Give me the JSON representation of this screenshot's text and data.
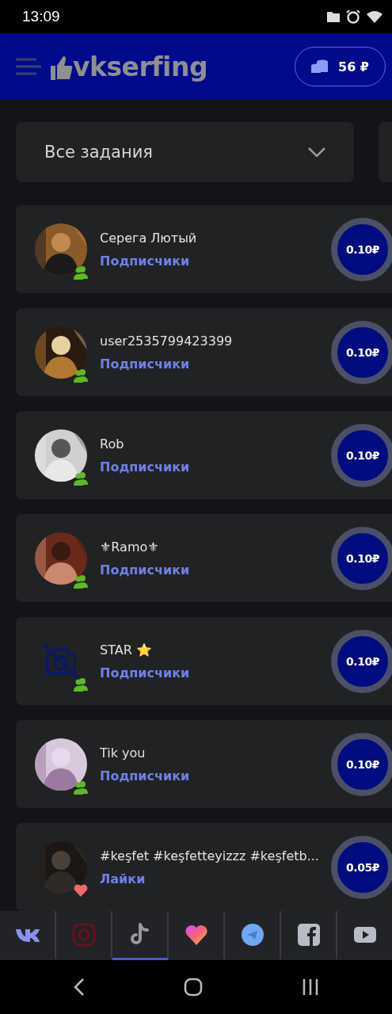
{
  "status_bar": {
    "time": "13:09"
  },
  "header": {
    "logo": "vkserfing",
    "balance": "56 ₽"
  },
  "filter": {
    "value": "Все задания",
    "expanded": false
  },
  "tasks": [
    {
      "name": "Серега Лютый",
      "type": "Подписчики",
      "kind": "subscribers",
      "has_photo": true,
      "price": "0.10₽"
    },
    {
      "name": "user2535799423399",
      "type": "Подписчики",
      "kind": "subscribers",
      "has_photo": true,
      "price": "0.10₽"
    },
    {
      "name": "Rob",
      "type": "Подписчики",
      "kind": "subscribers",
      "has_photo": true,
      "price": "0.10₽"
    },
    {
      "name": "⚜Ramo⚜",
      "type": "Подписчики",
      "kind": "subscribers",
      "has_photo": true,
      "price": "0.10₽"
    },
    {
      "name": "STAR ⭐",
      "type": "Подписчики",
      "kind": "subscribers",
      "has_photo": false,
      "price": "0.10₽"
    },
    {
      "name": "Tik you",
      "type": "Подписчики",
      "kind": "subscribers",
      "has_photo": true,
      "price": "0.10₽"
    },
    {
      "name": "#keşfet #keşfetteyizzz #keşfetb...",
      "type": "Лайки",
      "kind": "likes",
      "has_photo": true,
      "price": "0.05₽"
    }
  ],
  "social_tabs": [
    {
      "kind": "vk",
      "selected": false
    },
    {
      "kind": "instagram",
      "selected": false
    },
    {
      "kind": "tiktok",
      "selected": true
    },
    {
      "kind": "likee",
      "selected": false
    },
    {
      "kind": "telegram",
      "selected": false
    },
    {
      "kind": "facebook",
      "selected": false
    },
    {
      "kind": "youtube",
      "selected": false
    }
  ]
}
